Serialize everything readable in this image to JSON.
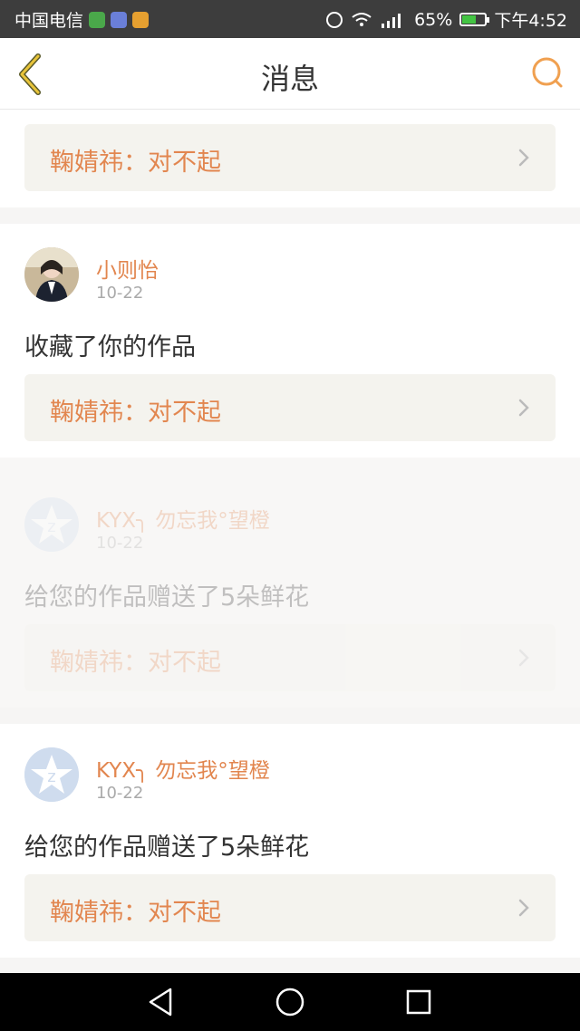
{
  "status_bar": {
    "carrier": "中国电信",
    "battery": "65%",
    "battery_level": 0.65,
    "time": "下午4:52"
  },
  "header": {
    "title": "消息"
  },
  "feed": {
    "top_reply": {
      "text": "鞠婧祎：对不起"
    },
    "items": [
      {
        "username": "小则怡",
        "date": "10-22",
        "action": "收藏了你的作品",
        "reply": "鞠婧祎：对不起"
      },
      {
        "username": "KYX╮ 勿忘我°望橙",
        "date": "10-22",
        "action": "给您的作品赠送了5朵鲜花",
        "reply": "鞠婧祎：对不起"
      },
      {
        "username": "KYX╮ 勿忘我°望橙",
        "date": "10-22",
        "action": "给您的作品赠送了5朵鲜花",
        "reply": "鞠婧祎：对不起"
      }
    ]
  },
  "colors": {
    "accent": "#e2864f",
    "reply_bg": "#f4f3ee",
    "status_bar": "#3d3d3d"
  },
  "icons": {
    "back": "chevron-left-icon",
    "search": "search-icon",
    "nav_back": "triangle-back-icon",
    "nav_home": "circle-home-icon",
    "nav_recent": "square-recent-icon"
  }
}
